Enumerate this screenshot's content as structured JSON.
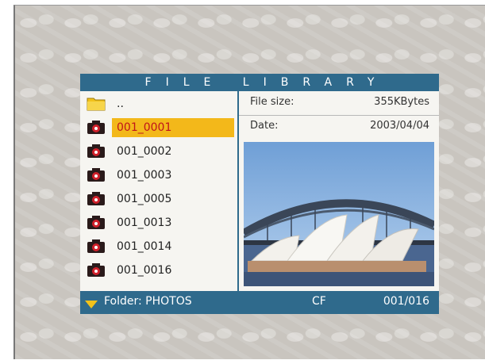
{
  "title": "FILE LIBRARY",
  "files": [
    {
      "name": "..",
      "icon": "folder-icon",
      "selected": false
    },
    {
      "name": "001_0001",
      "icon": "camera-icon",
      "selected": true
    },
    {
      "name": "001_0002",
      "icon": "camera-icon",
      "selected": false
    },
    {
      "name": "001_0003",
      "icon": "camera-icon",
      "selected": false
    },
    {
      "name": "001_0005",
      "icon": "camera-icon",
      "selected": false
    },
    {
      "name": "001_0013",
      "icon": "camera-icon",
      "selected": false
    },
    {
      "name": "001_0014",
      "icon": "camera-icon",
      "selected": false
    },
    {
      "name": "001_0016",
      "icon": "camera-icon",
      "selected": false
    }
  ],
  "info": {
    "file_size_label": "File size:",
    "file_size_value": "355KBytes",
    "date_label": "Date:",
    "date_value": "2003/04/04"
  },
  "status": {
    "folder": "Folder: PHOTOS",
    "card": "CF",
    "count": "001/016"
  },
  "colors": {
    "bar": "#2f6a8c",
    "selection": "#f3b81a",
    "selected_text": "#c0141a",
    "folder_icon": "#f2c21a"
  }
}
